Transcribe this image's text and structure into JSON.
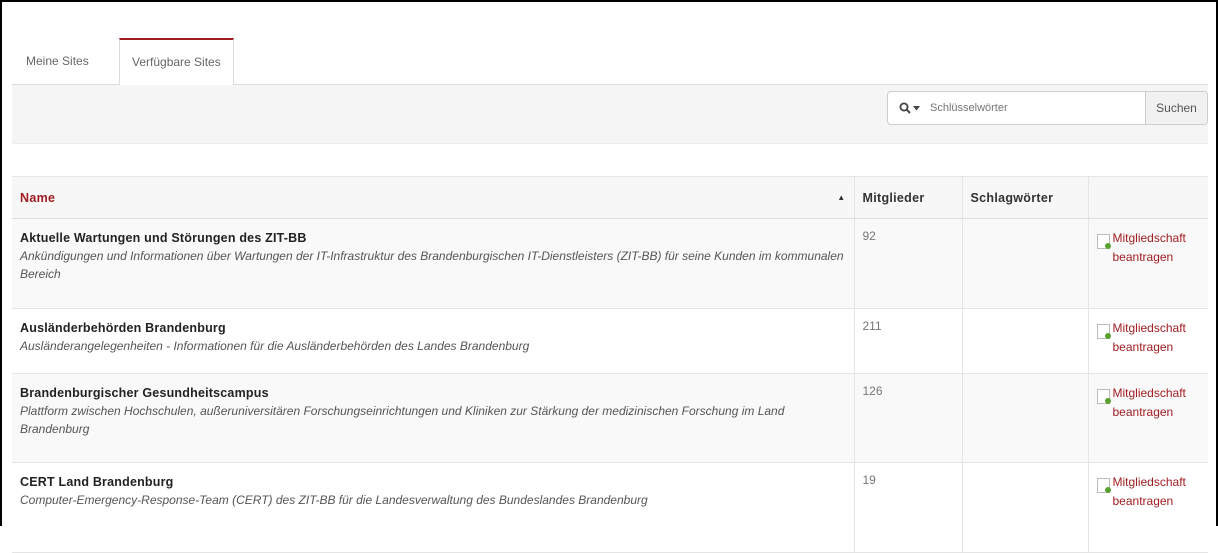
{
  "tabs": [
    {
      "label": "Meine Sites",
      "active": false
    },
    {
      "label": "Verfügbare Sites",
      "active": true
    }
  ],
  "search": {
    "placeholder": "Schlüsselwörter",
    "button_label": "Suchen",
    "icon": "search-icon",
    "dropdown_icon": "caret-down-icon"
  },
  "table": {
    "headers": {
      "name": "Name",
      "members": "Mitglieder",
      "tags": "Schlagwörter",
      "action": ""
    },
    "sort_indicator": "▲",
    "rows": [
      {
        "name": "Aktuelle Wartungen und Störungen des ZIT-BB",
        "description": "Ankündigungen und Informationen über Wartungen der IT-Infrastruktur des Brandenburgischen IT-Dienstleisters (ZIT-BB) für seine Kunden im kommunalen Bereich",
        "members": "92",
        "tags": "",
        "action_line1": "Mitgliedschaft",
        "action_line2": "beantragen"
      },
      {
        "name": "Ausländerbehörden Brandenburg",
        "description": "Ausländerangelegenheiten - Informationen für die Ausländerbehörden des Landes Brandenburg",
        "members": "211",
        "tags": "",
        "action_line1": "Mitgliedschaft",
        "action_line2": "beantragen"
      },
      {
        "name": "Brandenburgischer Gesundheitscampus",
        "description": "Plattform zwischen Hochschulen, außeruniversitären Forschungseinrichtungen und Kliniken zur Stärkung der medizinischen Forschung im Land Brandenburg",
        "members": "126",
        "tags": "",
        "action_line1": "Mitgliedschaft",
        "action_line2": "beantragen"
      },
      {
        "name": "CERT Land Brandenburg",
        "description": "Computer-Emergency-Response-Team (CERT) des ZIT-BB für die Landesverwaltung des Bundeslandes Brandenburg",
        "members": "19",
        "tags": "",
        "action_line1": "Mitgliedschaft",
        "action_line2": "beantragen"
      }
    ]
  },
  "colors": {
    "accent": "#a11d21",
    "link": "#a11d21",
    "status_icon": "#5aa02c"
  }
}
